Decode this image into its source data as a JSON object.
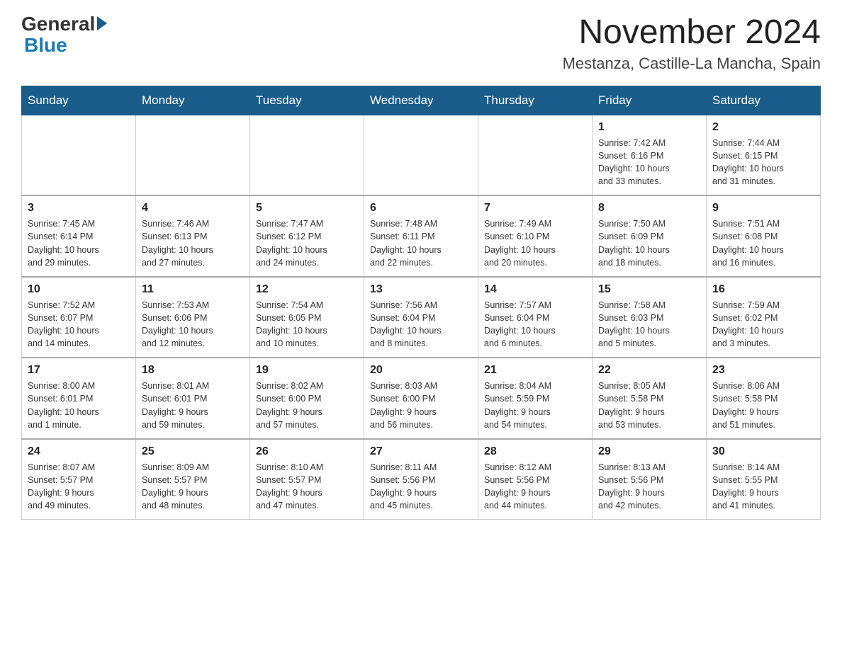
{
  "header": {
    "logo_general": "General",
    "logo_blue": "Blue",
    "month_title": "November 2024",
    "location": "Mestanza, Castille-La Mancha, Spain"
  },
  "days_of_week": [
    "Sunday",
    "Monday",
    "Tuesday",
    "Wednesday",
    "Thursday",
    "Friday",
    "Saturday"
  ],
  "weeks": [
    [
      {
        "day": "",
        "info": ""
      },
      {
        "day": "",
        "info": ""
      },
      {
        "day": "",
        "info": ""
      },
      {
        "day": "",
        "info": ""
      },
      {
        "day": "",
        "info": ""
      },
      {
        "day": "1",
        "info": "Sunrise: 7:42 AM\nSunset: 6:16 PM\nDaylight: 10 hours\nand 33 minutes."
      },
      {
        "day": "2",
        "info": "Sunrise: 7:44 AM\nSunset: 6:15 PM\nDaylight: 10 hours\nand 31 minutes."
      }
    ],
    [
      {
        "day": "3",
        "info": "Sunrise: 7:45 AM\nSunset: 6:14 PM\nDaylight: 10 hours\nand 29 minutes."
      },
      {
        "day": "4",
        "info": "Sunrise: 7:46 AM\nSunset: 6:13 PM\nDaylight: 10 hours\nand 27 minutes."
      },
      {
        "day": "5",
        "info": "Sunrise: 7:47 AM\nSunset: 6:12 PM\nDaylight: 10 hours\nand 24 minutes."
      },
      {
        "day": "6",
        "info": "Sunrise: 7:48 AM\nSunset: 6:11 PM\nDaylight: 10 hours\nand 22 minutes."
      },
      {
        "day": "7",
        "info": "Sunrise: 7:49 AM\nSunset: 6:10 PM\nDaylight: 10 hours\nand 20 minutes."
      },
      {
        "day": "8",
        "info": "Sunrise: 7:50 AM\nSunset: 6:09 PM\nDaylight: 10 hours\nand 18 minutes."
      },
      {
        "day": "9",
        "info": "Sunrise: 7:51 AM\nSunset: 6:08 PM\nDaylight: 10 hours\nand 16 minutes."
      }
    ],
    [
      {
        "day": "10",
        "info": "Sunrise: 7:52 AM\nSunset: 6:07 PM\nDaylight: 10 hours\nand 14 minutes."
      },
      {
        "day": "11",
        "info": "Sunrise: 7:53 AM\nSunset: 6:06 PM\nDaylight: 10 hours\nand 12 minutes."
      },
      {
        "day": "12",
        "info": "Sunrise: 7:54 AM\nSunset: 6:05 PM\nDaylight: 10 hours\nand 10 minutes."
      },
      {
        "day": "13",
        "info": "Sunrise: 7:56 AM\nSunset: 6:04 PM\nDaylight: 10 hours\nand 8 minutes."
      },
      {
        "day": "14",
        "info": "Sunrise: 7:57 AM\nSunset: 6:04 PM\nDaylight: 10 hours\nand 6 minutes."
      },
      {
        "day": "15",
        "info": "Sunrise: 7:58 AM\nSunset: 6:03 PM\nDaylight: 10 hours\nand 5 minutes."
      },
      {
        "day": "16",
        "info": "Sunrise: 7:59 AM\nSunset: 6:02 PM\nDaylight: 10 hours\nand 3 minutes."
      }
    ],
    [
      {
        "day": "17",
        "info": "Sunrise: 8:00 AM\nSunset: 6:01 PM\nDaylight: 10 hours\nand 1 minute."
      },
      {
        "day": "18",
        "info": "Sunrise: 8:01 AM\nSunset: 6:01 PM\nDaylight: 9 hours\nand 59 minutes."
      },
      {
        "day": "19",
        "info": "Sunrise: 8:02 AM\nSunset: 6:00 PM\nDaylight: 9 hours\nand 57 minutes."
      },
      {
        "day": "20",
        "info": "Sunrise: 8:03 AM\nSunset: 6:00 PM\nDaylight: 9 hours\nand 56 minutes."
      },
      {
        "day": "21",
        "info": "Sunrise: 8:04 AM\nSunset: 5:59 PM\nDaylight: 9 hours\nand 54 minutes."
      },
      {
        "day": "22",
        "info": "Sunrise: 8:05 AM\nSunset: 5:58 PM\nDaylight: 9 hours\nand 53 minutes."
      },
      {
        "day": "23",
        "info": "Sunrise: 8:06 AM\nSunset: 5:58 PM\nDaylight: 9 hours\nand 51 minutes."
      }
    ],
    [
      {
        "day": "24",
        "info": "Sunrise: 8:07 AM\nSunset: 5:57 PM\nDaylight: 9 hours\nand 49 minutes."
      },
      {
        "day": "25",
        "info": "Sunrise: 8:09 AM\nSunset: 5:57 PM\nDaylight: 9 hours\nand 48 minutes."
      },
      {
        "day": "26",
        "info": "Sunrise: 8:10 AM\nSunset: 5:57 PM\nDaylight: 9 hours\nand 47 minutes."
      },
      {
        "day": "27",
        "info": "Sunrise: 8:11 AM\nSunset: 5:56 PM\nDaylight: 9 hours\nand 45 minutes."
      },
      {
        "day": "28",
        "info": "Sunrise: 8:12 AM\nSunset: 5:56 PM\nDaylight: 9 hours\nand 44 minutes."
      },
      {
        "day": "29",
        "info": "Sunrise: 8:13 AM\nSunset: 5:56 PM\nDaylight: 9 hours\nand 42 minutes."
      },
      {
        "day": "30",
        "info": "Sunrise: 8:14 AM\nSunset: 5:55 PM\nDaylight: 9 hours\nand 41 minutes."
      }
    ]
  ]
}
